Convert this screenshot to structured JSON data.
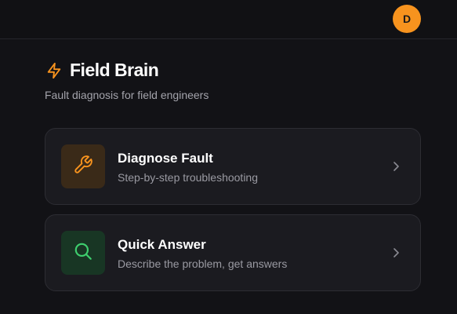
{
  "header": {
    "avatar_initial": "D"
  },
  "main": {
    "title": "Field Brain",
    "subtitle": "Fault diagnosis for field engineers",
    "accent_color": "#f7931e",
    "cards": [
      {
        "title": "Diagnose Fault",
        "description": "Step-by-step troubleshooting",
        "icon": "wrench-icon",
        "icon_color": "#f7931e"
      },
      {
        "title": "Quick Answer",
        "description": "Describe the problem, get answers",
        "icon": "search-icon",
        "icon_color": "#3ecf6e"
      }
    ]
  }
}
